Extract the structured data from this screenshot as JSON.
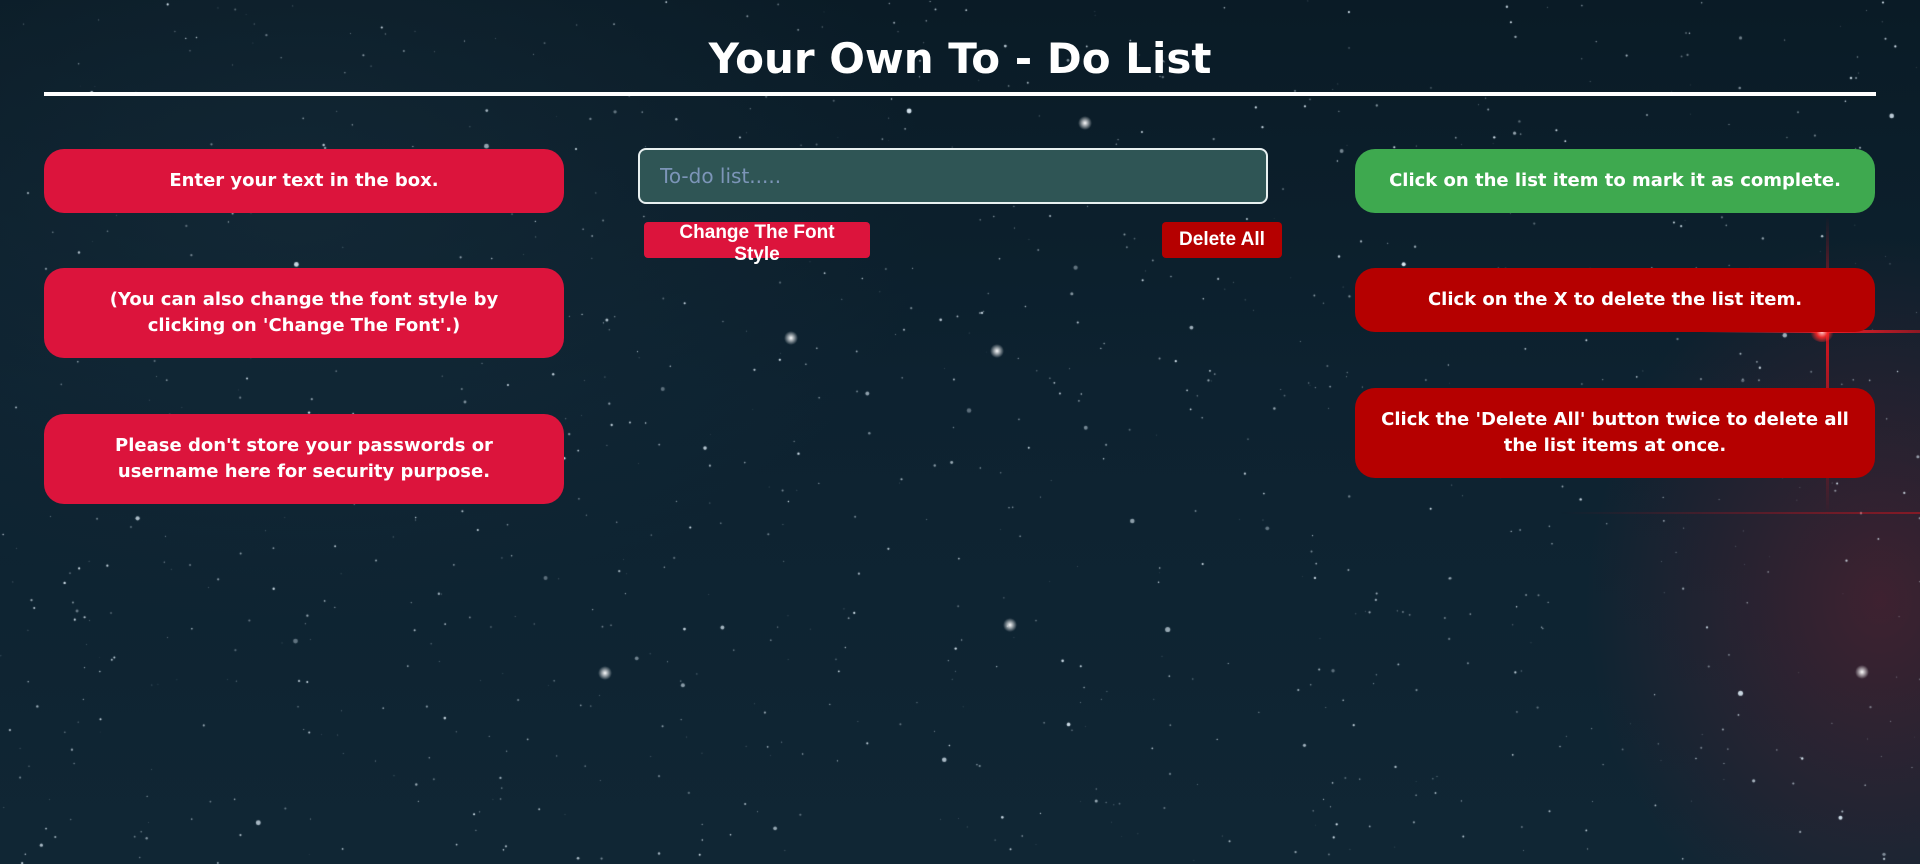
{
  "header": {
    "title": "Your Own To - Do List"
  },
  "left_panel": {
    "cards": [
      {
        "text": "Enter your text in the box."
      },
      {
        "text": "(You can also change the font style by clicking on 'Change The Font'.)"
      },
      {
        "text": "Please don't store your passwords or username here for security purpose."
      }
    ]
  },
  "center": {
    "input": {
      "placeholder": "To-do list.....",
      "value": ""
    },
    "change_font_label": "Change The Font Style",
    "delete_all_label": "Delete All"
  },
  "right_panel": {
    "cards": [
      {
        "text": "Click on the list item to mark it as complete."
      },
      {
        "text": "Click on the X to delete the list item."
      },
      {
        "text": "Click the 'Delete All' button twice to delete all the list items at once."
      }
    ]
  },
  "colors": {
    "crimson": "#dc143c",
    "dark_red": "#b50000",
    "green": "#3ea94f",
    "input_bg": "#2f5555",
    "background": "#0d2230"
  }
}
